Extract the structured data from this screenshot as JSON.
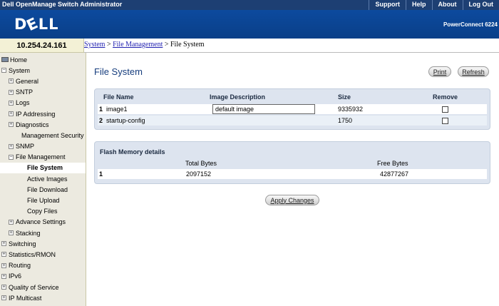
{
  "header": {
    "app_title": "Dell OpenManage Switch Administrator",
    "links": [
      "Support",
      "Help",
      "About",
      "Log Out"
    ],
    "brand": "DELL",
    "model": "PowerConnect 6224"
  },
  "ip_address": "10.254.24.161",
  "breadcrumb": {
    "items": [
      "System",
      "File Management"
    ],
    "current": "File System",
    "sep": ">"
  },
  "sidebar": {
    "items": [
      {
        "label": "Home",
        "level": 0,
        "exp": "",
        "icon": "home-icon"
      },
      {
        "label": "System",
        "level": 0,
        "exp": "−"
      },
      {
        "label": "General",
        "level": 1,
        "exp": "+"
      },
      {
        "label": "SNTP",
        "level": 1,
        "exp": "+"
      },
      {
        "label": "Logs",
        "level": 1,
        "exp": "+"
      },
      {
        "label": "IP Addressing",
        "level": 1,
        "exp": "+"
      },
      {
        "label": "Diagnostics",
        "level": 1,
        "exp": "+"
      },
      {
        "label": "Management Security",
        "level": 1,
        "exp": ""
      },
      {
        "label": "SNMP",
        "level": 1,
        "exp": "+"
      },
      {
        "label": "File Management",
        "level": 1,
        "exp": "−"
      },
      {
        "label": "File System",
        "level": 2,
        "exp": "",
        "selected": true
      },
      {
        "label": "Active Images",
        "level": 2,
        "exp": ""
      },
      {
        "label": "File Download",
        "level": 2,
        "exp": ""
      },
      {
        "label": "File Upload",
        "level": 2,
        "exp": ""
      },
      {
        "label": "Copy Files",
        "level": 2,
        "exp": ""
      },
      {
        "label": "Advance Settings",
        "level": 1,
        "exp": "+"
      },
      {
        "label": "Stacking",
        "level": 1,
        "exp": "+"
      },
      {
        "label": "Switching",
        "level": 0,
        "exp": "+"
      },
      {
        "label": "Statistics/RMON",
        "level": 0,
        "exp": "+"
      },
      {
        "label": "Routing",
        "level": 0,
        "exp": "+"
      },
      {
        "label": "IPv6",
        "level": 0,
        "exp": "+"
      },
      {
        "label": "Quality of Service",
        "level": 0,
        "exp": "+"
      },
      {
        "label": "IP Multicast",
        "level": 0,
        "exp": "+"
      }
    ]
  },
  "main": {
    "title": "File System",
    "print_label": "Print",
    "refresh_label": "Refresh",
    "files": {
      "headers": {
        "name": "File Name",
        "desc": "Image Description",
        "size": "Size",
        "remove": "Remove"
      },
      "rows": [
        {
          "index": "1",
          "name": "image1",
          "desc": "default image",
          "size": "9335932",
          "remove": false
        },
        {
          "index": "2",
          "name": "startup-config",
          "desc": "",
          "size": "1750",
          "remove": false
        }
      ]
    },
    "flash": {
      "title": "Flash Memory details",
      "headers": {
        "total": "Total Bytes",
        "free": "Free Bytes"
      },
      "row": {
        "index": "1",
        "total": "2097152",
        "free": "42877267"
      }
    },
    "apply_label": "Apply Changes"
  },
  "colors": {
    "title_bar": "#1d3f73",
    "brand_bar": "#0c4a9e",
    "sidebar_bg": "#eceae0",
    "panel_bg": "#dde4ef",
    "title_text": "#163d7d"
  }
}
